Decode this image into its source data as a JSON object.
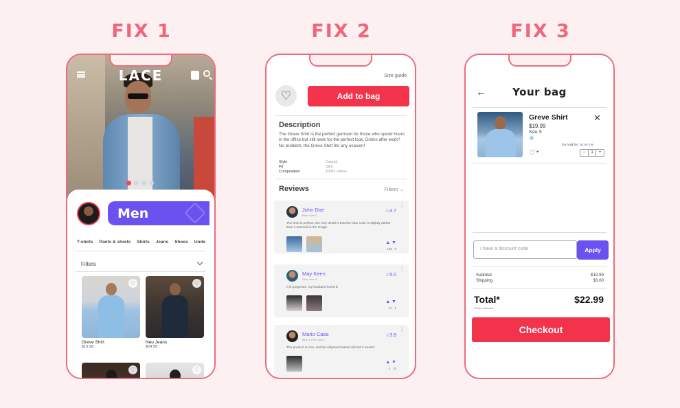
{
  "titles": {
    "fix1": "FIX 1",
    "fix2": "FIX 2",
    "fix3": "FIX 3"
  },
  "colors": {
    "accent_purple": "#6b52f0",
    "accent_red": "#f3334b",
    "frame_pink": "#ec6b7f",
    "background": "#fcf0f1"
  },
  "phone1": {
    "logo": "LACE",
    "icons": [
      "menu-icon",
      "shopping-bag-icon",
      "search-icon"
    ],
    "category_banner": "Men",
    "categories": [
      "T-shirts",
      "Pants & shorts",
      "Shirts",
      "Jeans",
      "Shoes",
      "Unde"
    ],
    "filters_label": "Filters",
    "products": [
      {
        "name": "Greve Shirt",
        "price": "$19.99"
      },
      {
        "name": "Neu Jeans",
        "price": "$24.99"
      }
    ]
  },
  "phone2": {
    "size_guide": "Size guide",
    "add_to_bag": "Add to bag",
    "description_title": "Description",
    "description_text": "The Greve Shirt is the perfect garment for those who spend hours in the office but still seek for the perfect look. Drinks after work? No problem, the Greve Shirt fits any ocasion!",
    "specs": [
      {
        "label": "Style",
        "value": "Casual"
      },
      {
        "label": "Fit",
        "value": "Slim"
      },
      {
        "label": "Composition",
        "value": "100% cotton"
      }
    ],
    "reviews_title": "Reviews",
    "filters_label": "Filters",
    "reviews": [
      {
        "name": "John Doe",
        "meta": "Blue, size S",
        "rating": "4.7",
        "text": "The shirt is perfect, the only detail is that the blue color is slightly darker than it seemed in the image.",
        "likes": "108",
        "dislikes": "0"
      },
      {
        "name": "May Keen",
        "meta": "Pink, size M",
        "rating": "5.0",
        "text": "It is gorgeous, my husband loved it!",
        "likes": "21",
        "dislikes": "1"
      },
      {
        "name": "Mario Casa",
        "meta": "Blue & Pink, size L",
        "rating": "3.8",
        "text": "The product is nice, but the shipment lasted almost 2 weeks!",
        "likes": "0",
        "dislikes": "10"
      }
    ]
  },
  "phone3": {
    "title": "Your bag",
    "item": {
      "name": "Greve Shirt",
      "price": "$19.99",
      "size": "Size S",
      "on_hold_label": "On hold for:",
      "on_hold_time": "30:00 min",
      "quantity": "1"
    },
    "discount_placeholder": "I have a discount code",
    "apply_label": "Apply",
    "subtotal_label": "Subtotal",
    "subtotal_value": "$19.99",
    "shipping_label": "Shipping",
    "shipping_value": "$3.00",
    "total_label": "Total*",
    "total_value": "$22.99",
    "taxes_note": "*Taxes included",
    "checkout_label": "Checkout"
  }
}
